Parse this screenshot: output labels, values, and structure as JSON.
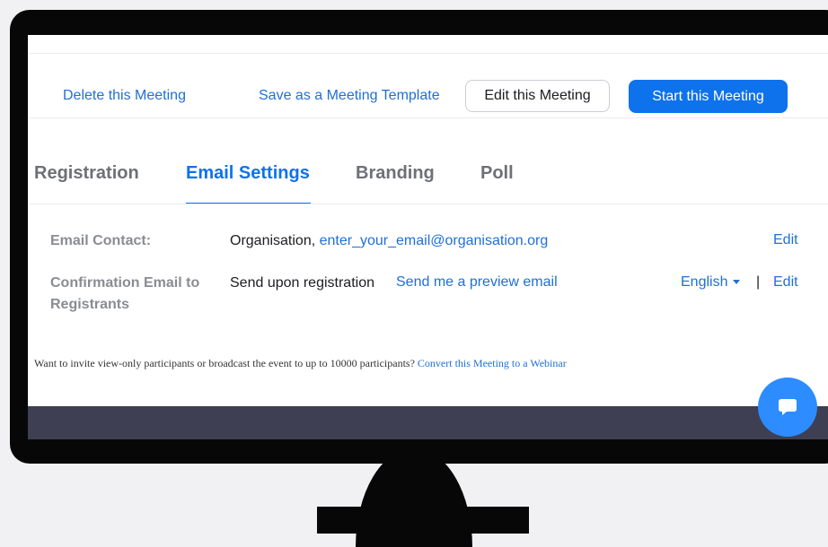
{
  "actions": {
    "delete_label": "Delete this Meeting",
    "save_template_label": "Save as a Meeting Template",
    "edit_label": "Edit this Meeting",
    "start_label": "Start this Meeting"
  },
  "tabs": [
    {
      "label": "Registration",
      "active": false
    },
    {
      "label": "Email Settings",
      "active": true
    },
    {
      "label": "Branding",
      "active": false
    },
    {
      "label": "Poll",
      "active": false
    }
  ],
  "email_contact": {
    "label": "Email Contact:",
    "org_prefix": "Organisation,",
    "email": "enter_your_email@organisation.org",
    "edit_label": "Edit"
  },
  "confirmation": {
    "label_line1": "Confirmation Email to",
    "label_line2": "Registrants",
    "value": "Send upon registration",
    "preview_link": "Send me a preview email",
    "language": "English",
    "separator": "|",
    "edit_label": "Edit"
  },
  "footer": {
    "note": "Want to invite view-only participants or broadcast the event to up to 10000 participants?",
    "link": "Convert this Meeting to a Webinar"
  },
  "icons": {
    "chat": "chat-bubble-icon",
    "language_caret": "caret-down-icon"
  },
  "colors": {
    "accent": "#0e72ed",
    "link": "#1f6fd6",
    "dark_bar": "#3e3f52",
    "chat_button": "#2d8cff",
    "monitor": "#070707"
  }
}
